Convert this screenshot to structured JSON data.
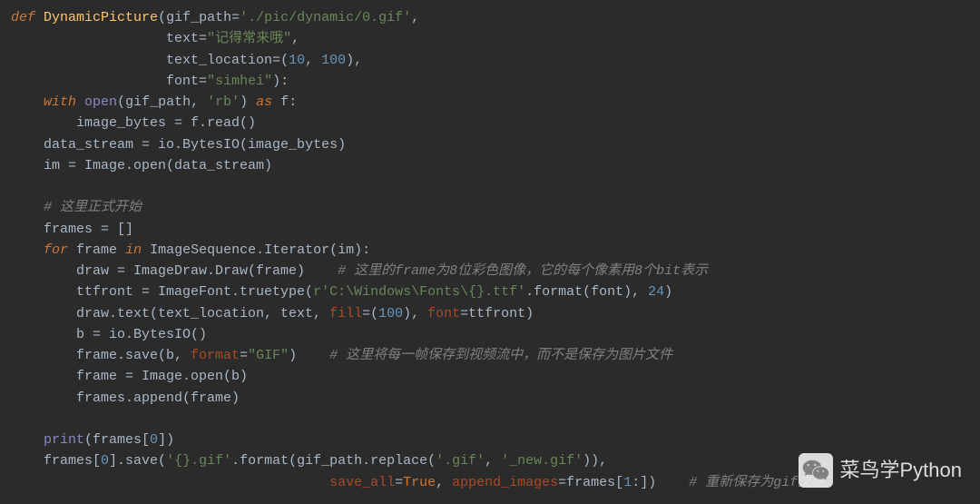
{
  "code": {
    "l1_def": "def",
    "l1_fn": "DynamicPicture",
    "l1_p1": "gif_path",
    "l1_v1": "'./pic/dynamic/0.gif'",
    "l2_p": "text",
    "l2_v": "\"记得常来哦\"",
    "l3_p": "text_location",
    "l3_v1": "10",
    "l3_v2": "100",
    "l4_p": "font",
    "l4_v": "\"simhei\"",
    "l5_with": "with",
    "l5_open": "open",
    "l5_arg1": "gif_path",
    "l5_arg2": "'rb'",
    "l5_as": "as",
    "l5_f": "f",
    "l6": "image_bytes = f.read()",
    "l7": "data_stream = io.BytesIO(image_bytes)",
    "l8": "im = Image.open(data_stream)",
    "c1": "# 这里正式开始",
    "l9": "frames = []",
    "l10_for": "for",
    "l10_var": "frame",
    "l10_in": "in",
    "l10_iter": "ImageSequence.Iterator(im):",
    "l11": "draw = ImageDraw.Draw(frame)",
    "c2": "# 这里的frame为8位彩色图像，它的每个像素用8个bit表示",
    "l12a": "ttfront = ImageFont.truetype(",
    "l12r": "r",
    "l12s": "'C:\\Windows\\Fonts\\{}.ttf'",
    "l12b": ".format(font), ",
    "l12n": "24",
    "l12c": ")",
    "l13a": "draw.text(text_location, text, ",
    "l13fill": "fill",
    "l13v": "100",
    "l13font": "font",
    "l13ft": "ttfront)",
    "l14": "b = io.BytesIO()",
    "l15a": "frame.save(b, ",
    "l15fmt": "format",
    "l15v": "\"GIF\"",
    "l15b": ")",
    "c3": "# 这里将每一帧保存到视频流中，而不是保存为图片文件",
    "l16": "frame = Image.open(b)",
    "l17": "frames.append(frame)",
    "l18a": "print",
    "l18b": "(frames[",
    "l18n": "0",
    "l18c": "])",
    "l19a": "frames[",
    "l19n": "0",
    "l19b": "].save(",
    "l19s": "'{}.gif'",
    "l19c": ".format(gif_path.replace(",
    "l19s2": "'.gif'",
    "l19s3": "'_new.gif'",
    "l19d": ")),",
    "l20sa": "save_all",
    "l20t": "True",
    "l20ai": "append_images",
    "l20b": "frames[",
    "l20n": "1",
    "l20c": ":])",
    "c4": "# 重新保存为gif文件"
  },
  "watermark": {
    "text": "菜鸟学Python"
  }
}
